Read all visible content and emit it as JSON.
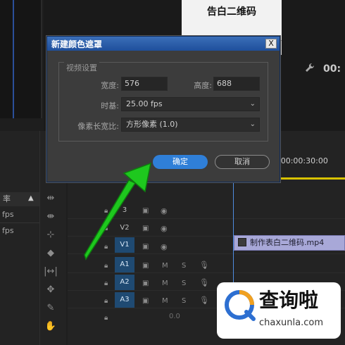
{
  "preview": {
    "title": "告白二维码"
  },
  "monitor": {
    "timecode_right": "00:"
  },
  "project": {
    "tab_label": "率",
    "fps_rows": [
      "fps",
      "fps"
    ]
  },
  "timeline": {
    "ruler_time": ":00:00:30:00",
    "tracks": [
      {
        "label": "3",
        "type": "video"
      },
      {
        "label": "V2",
        "type": "video"
      },
      {
        "label": "V1",
        "type": "video"
      },
      {
        "label": "A1",
        "type": "audio"
      },
      {
        "label": "A2",
        "type": "audio"
      },
      {
        "label": "A3",
        "type": "audio"
      }
    ],
    "audio_m": "M",
    "audio_s": "S",
    "clip_name": "制作表白二维码.mp4",
    "bottom_value": "0.0"
  },
  "dialog": {
    "title": "新建颜色遮罩",
    "close_label": "X",
    "group_label": "视频设置",
    "width_label": "宽度:",
    "width_value": "576",
    "height_label": "高度:",
    "height_value": "688",
    "timebase_label": "时基:",
    "timebase_value": "25.00 fps",
    "pixel_aspect_label": "像素长宽比:",
    "pixel_aspect_value": "方形像素 (1.0)",
    "ok_label": "确定",
    "cancel_label": "取消"
  },
  "watermark": {
    "text": "查询啦",
    "sub": "chaxunla.com"
  },
  "colors": {
    "accent": "#2f7fd8",
    "arrow": "#22cc22",
    "titlebar": "#1f4f9c"
  }
}
